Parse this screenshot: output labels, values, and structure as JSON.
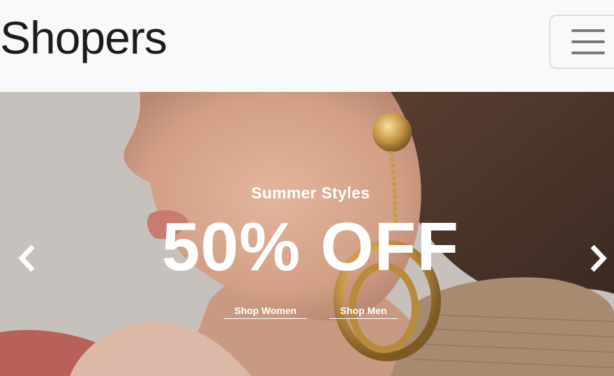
{
  "navbar": {
    "brand": "Shopers",
    "toggler_icon": "hamburger-menu-icon"
  },
  "hero": {
    "subtitle": "Summer Styles",
    "headline": "50% OFF",
    "links": [
      {
        "label": "Shop Women"
      },
      {
        "label": "Shop Men"
      }
    ],
    "prev_icon": "chevron-left-icon",
    "next_icon": "chevron-right-icon"
  },
  "colors": {
    "navbar_bg": "#f8f9fa",
    "brand_text": "#1c1c1c",
    "hero_text": "#ffffff"
  }
}
